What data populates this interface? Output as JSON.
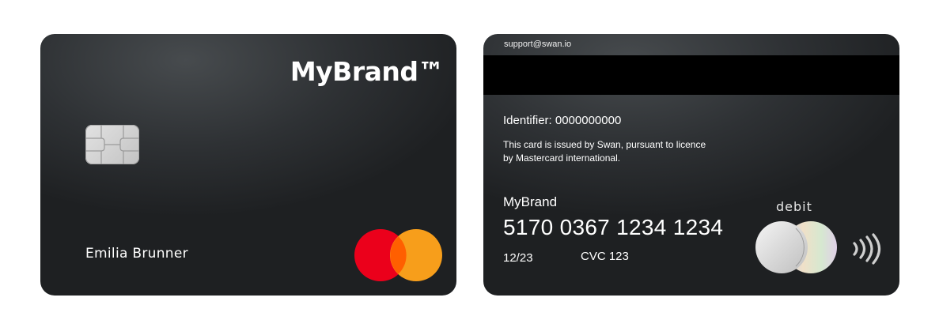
{
  "front": {
    "brand": "MyBrand™",
    "cardholder_name": "Emilia Brunner",
    "network_logo": "mastercard-logo"
  },
  "back": {
    "support_email": "support@swan.io",
    "identifier": "Identifier: 0000000000",
    "legal_line_1": "This card is issued by Swan, pursuant to licence",
    "legal_line_2": "by Mastercard international.",
    "brand": "MyBrand",
    "card_number": "5170 0367 1234 1234",
    "expiry": "12/23",
    "cvc": "CVC 123",
    "card_type": "debit",
    "icons": [
      "hologram-icon",
      "contactless-icon"
    ]
  },
  "colors": {
    "card_dark": "#2e3134",
    "mastercard_red": "#eb001b",
    "mastercard_orange": "#f79e1b",
    "mastercard_overlap": "#ff5f00"
  }
}
